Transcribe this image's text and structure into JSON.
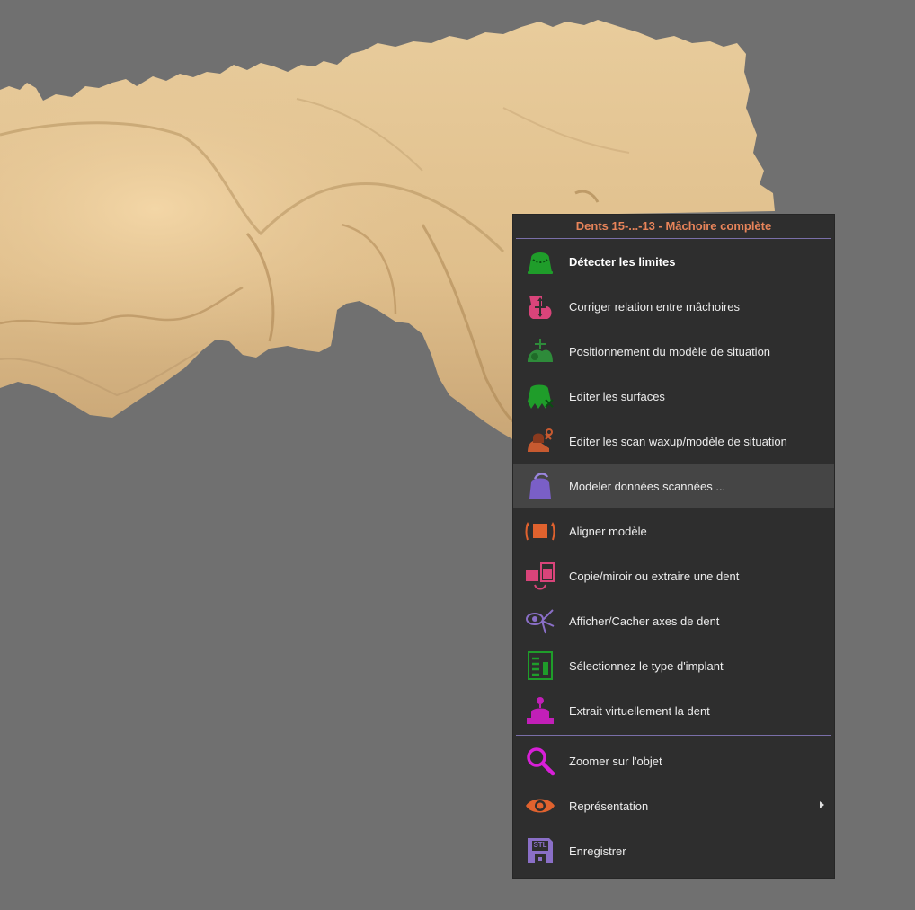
{
  "menu": {
    "title": "Dents 15-...-13 - Mâchoire complète",
    "group1": [
      {
        "label": "Détecter les limites",
        "icon": "detect-margin-icon",
        "color": "#1f9d2a",
        "bold": true
      },
      {
        "label": "Corriger relation entre mâchoires",
        "icon": "correct-bite-icon",
        "color": "#d9447a"
      },
      {
        "label": "Positionnement du modèle de situation",
        "icon": "situation-model-position-icon",
        "color": "#2e8b3a"
      },
      {
        "label": "Editer les surfaces",
        "icon": "edit-surfaces-icon",
        "color": "#1f9d2a"
      },
      {
        "label": "Editer les scan waxup/modèle de situation",
        "icon": "edit-waxup-scan-icon",
        "color": "#c75a30"
      },
      {
        "label": "Modeler données scannées ...",
        "icon": "sculpt-scan-data-icon",
        "color": "#7a5fc7",
        "hover": true
      },
      {
        "label": "Aligner modèle",
        "icon": "align-model-icon",
        "color": "#e0622e"
      },
      {
        "label": "Copie/miroir ou extraire une dent",
        "icon": "copy-mirror-tooth-icon",
        "color": "#d9447a"
      },
      {
        "label": "Afficher/Cacher axes de dent",
        "icon": "tooth-axes-icon",
        "color": "#8a6fc7"
      },
      {
        "label": "Sélectionnez le type d'implant",
        "icon": "implant-type-icon",
        "color": "#1f9d2a"
      },
      {
        "label": "Extrait virtuellement la dent",
        "icon": "virtual-extraction-icon",
        "color": "#c21fb8"
      }
    ],
    "group2": [
      {
        "label": "Zoomer sur l'objet",
        "icon": "zoom-icon",
        "color": "#d81fd8"
      },
      {
        "label": "Représentation",
        "icon": "eye-icon",
        "color": "#e0622e",
        "submenu": true
      },
      {
        "label": "Enregistrer",
        "icon": "save-stl-icon",
        "color": "#8a6fc7",
        "badge": "STL"
      }
    ]
  },
  "colors": {
    "background": "#707070",
    "model": "#e3c393",
    "menu_bg": "#2e2e2e",
    "menu_title": "#e8845a",
    "menu_separator": "#7a6fa8",
    "hover_bg": "#454545"
  }
}
